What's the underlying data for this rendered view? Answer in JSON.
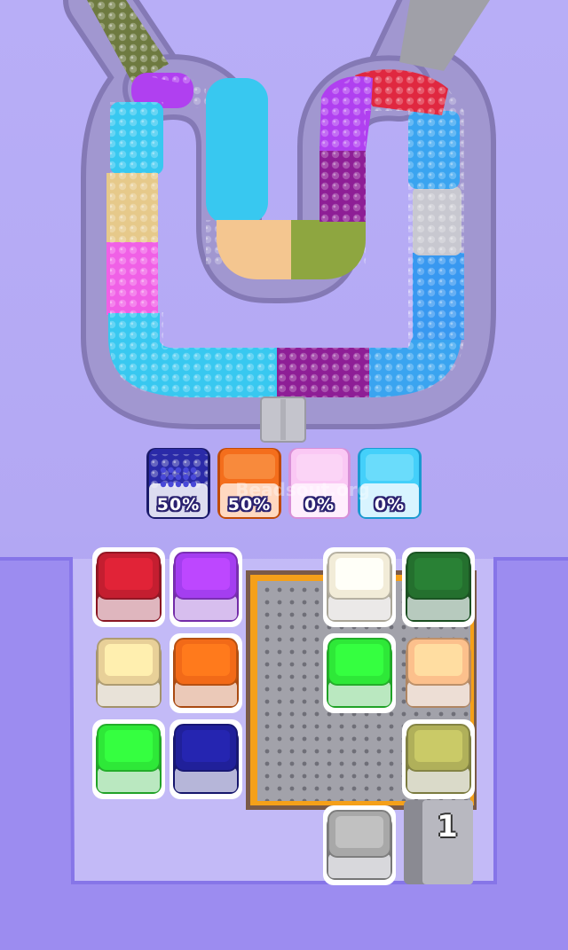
{
  "watermark": "Beadsout.org",
  "colors": {
    "background": "#b8aef7",
    "track": "#857db3",
    "tray": "#9b8cf0",
    "grid_frame_orange": "#f5a019",
    "grid_frame_brown": "#7a5a48"
  },
  "track_segments": [
    {
      "color": "#6e7a40"
    },
    {
      "color": "#c88a2c"
    },
    {
      "color": "#b040f0"
    },
    {
      "color": "#38c8f0"
    },
    {
      "color": "#e6c98a"
    },
    {
      "color": "#f060e6"
    },
    {
      "color": "#38c8f0"
    },
    {
      "color": "#38c8f0"
    },
    {
      "color": "#38c8f0"
    },
    {
      "color": "#8e1e96"
    },
    {
      "color": "#38a0f0"
    },
    {
      "color": "#3898f0"
    },
    {
      "color": "#3aa4f0"
    },
    {
      "color": "#c8c8d0"
    },
    {
      "color": "#3aa4f0"
    },
    {
      "color": "#e02840"
    },
    {
      "color": "#b040f0"
    },
    {
      "color": "#8e1e96"
    },
    {
      "color": "#8ea640"
    },
    {
      "color": "#f4c690"
    },
    {
      "color": "#38c8f0"
    },
    {
      "color": "#b040f0"
    },
    {
      "color": "#a0a0a8"
    }
  ],
  "collectors": [
    {
      "color": "#23239a",
      "label": "50%",
      "progress": 0.5
    },
    {
      "color": "#f06818",
      "label": "50%",
      "progress": 0.5
    },
    {
      "color": "#f6bff0",
      "label": "0%",
      "progress": 0
    },
    {
      "color": "#3cc8f8",
      "label": "0%",
      "progress": 0
    }
  ],
  "buckets": [
    {
      "id": "red",
      "color": "#c41e30"
    },
    {
      "id": "purple",
      "color": "#a43ef0"
    },
    {
      "id": "cream",
      "color": "#f2ecd8"
    },
    {
      "id": "dark-green",
      "color": "#24702e"
    },
    {
      "id": "tan",
      "color": "#e8d098"
    },
    {
      "id": "orange",
      "color": "#f26a18"
    },
    {
      "id": "green",
      "color": "#2ee838"
    },
    {
      "id": "peach",
      "color": "#fcc08c"
    },
    {
      "id": "lime",
      "color": "#2ee838"
    },
    {
      "id": "navy",
      "color": "#20209a"
    },
    {
      "id": "olive",
      "color": "#b0b05a"
    },
    {
      "id": "gray",
      "color": "#a8a8a8"
    }
  ],
  "queue_counter": "1"
}
